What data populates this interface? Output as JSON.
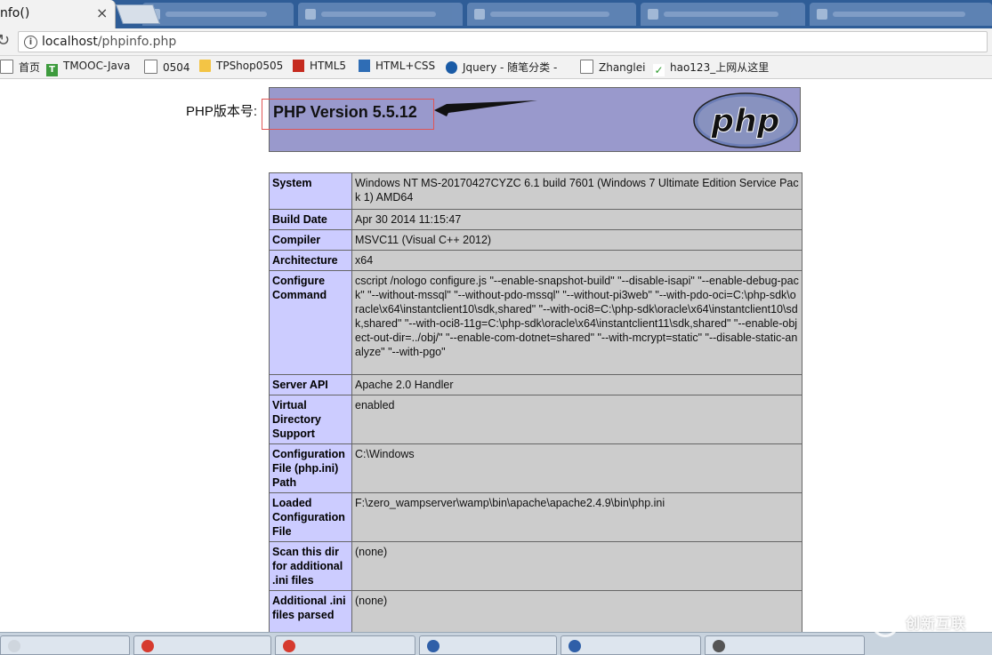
{
  "browser": {
    "tab_title": "nfo()",
    "tab_close": "×",
    "address": {
      "host": "localhost",
      "path": "/phpinfo.php"
    },
    "bookmarks": [
      {
        "label": "首页",
        "icon": "doc-icon"
      },
      {
        "label": "TMOOC-Java",
        "icon": "tmooc-icon"
      },
      {
        "label": "0504",
        "icon": "doc-icon"
      },
      {
        "label": "TPShop0505",
        "icon": "folder-icon"
      },
      {
        "label": "HTML5",
        "icon": "html5-icon"
      },
      {
        "label": "HTML+CSS",
        "icon": "blue-icon"
      },
      {
        "label": "Jquery - 随笔分类 -",
        "icon": "jquery-icon"
      },
      {
        "label": "Zhanglei",
        "icon": "doc-icon"
      },
      {
        "label": "hao123_上网从这里",
        "icon": "hao123-icon"
      }
    ]
  },
  "page": {
    "annotation_label": "PHP版本号:",
    "version": "PHP Version 5.5.12",
    "logo_text": "php",
    "rows": [
      {
        "key": "System",
        "value": "Windows NT MS-20170427CYZC 6.1 build 7601 (Windows 7 Ultimate Edition Service Pack 1) AMD64"
      },
      {
        "key": "Build Date",
        "value": "Apr 30 2014 11:15:47"
      },
      {
        "key": "Compiler",
        "value": "MSVC11 (Visual C++ 2012)"
      },
      {
        "key": "Architecture",
        "value": "x64"
      },
      {
        "key": "Configure Command",
        "value": "cscript /nologo configure.js \"--enable-snapshot-build\" \"--disable-isapi\" \"--enable-debug-pack\" \"--without-mssql\" \"--without-pdo-mssql\" \"--without-pi3web\" \"--with-pdo-oci=C:\\php-sdk\\oracle\\x64\\instantclient10\\sdk,shared\" \"--with-oci8=C:\\php-sdk\\oracle\\x64\\instantclient10\\sdk,shared\" \"--with-oci8-11g=C:\\php-sdk\\oracle\\x64\\instantclient11\\sdk,shared\" \"--enable-object-out-dir=../obj/\" \"--enable-com-dotnet=shared\" \"--with-mcrypt=static\" \"--disable-static-analyze\" \"--with-pgo\""
      },
      {
        "key": "Server API",
        "value": "Apache 2.0 Handler"
      },
      {
        "key": "Virtual Directory Support",
        "value": "enabled"
      },
      {
        "key": "Configuration File (php.ini) Path",
        "value": "C:\\Windows"
      },
      {
        "key": "Loaded Configuration File",
        "value": "F:\\zero_wampserver\\wamp\\bin\\apache\\apache2.4.9\\bin\\php.ini"
      },
      {
        "key": "Scan this dir for additional .ini files",
        "value": "(none)"
      },
      {
        "key": "Additional .ini files parsed",
        "value": "(none)"
      }
    ]
  },
  "watermark": {
    "text": "创新互联"
  },
  "colors": {
    "header_bg": "#9999cc",
    "key_bg": "#ccccff",
    "value_bg": "#cccccc",
    "annotation_box": "#e05555"
  }
}
